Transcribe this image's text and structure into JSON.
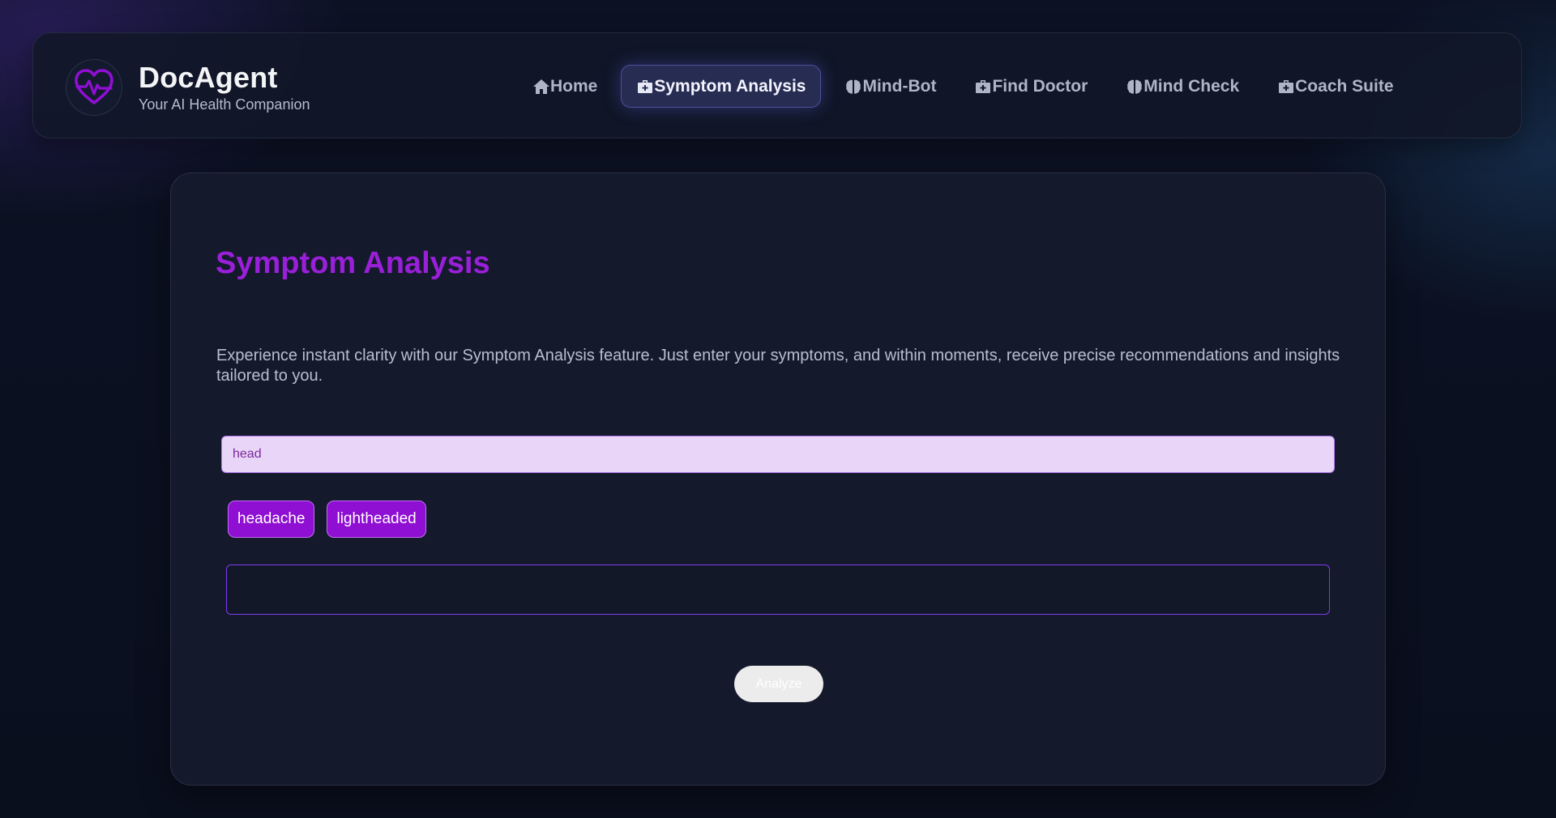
{
  "brand": {
    "title": "DocAgent",
    "subtitle": "Your AI Health Companion",
    "logo_icon": "heart-pulse-icon",
    "accent_color": "#9a1fd9"
  },
  "nav": {
    "items": [
      {
        "label": "Home",
        "icon": "home-icon",
        "active": false
      },
      {
        "label": "Symptom Analysis",
        "icon": "medkit-icon",
        "active": true
      },
      {
        "label": "Mind-Bot",
        "icon": "brain-icon",
        "active": false
      },
      {
        "label": "Find Doctor",
        "icon": "medkit-icon",
        "active": false
      },
      {
        "label": "Mind Check",
        "icon": "brain-icon",
        "active": false
      },
      {
        "label": "Coach Suite",
        "icon": "medkit-icon",
        "active": false
      }
    ]
  },
  "main": {
    "title": "Symptom Analysis",
    "description": "Experience instant clarity with our Symptom Analysis feature. Just enter your symptoms, and within moments, receive precise recommendations and insights tailored to you.",
    "search": {
      "value": "head",
      "placeholder": ""
    },
    "suggestions": [
      "headache",
      "lightheaded"
    ],
    "selected_symptoms_value": "",
    "analyze_label": "Analyze"
  }
}
